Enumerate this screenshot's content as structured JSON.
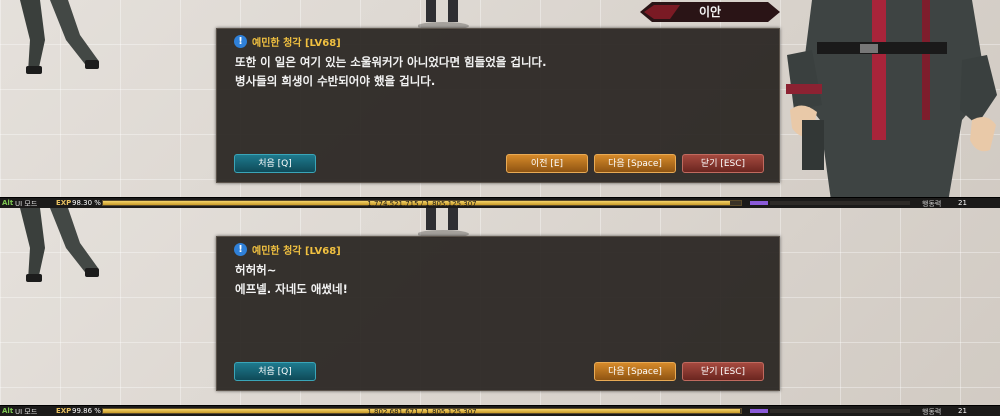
{
  "screens": [
    {
      "nameplate": "이안",
      "dialog": {
        "speaker": "예민한 청각 [LV68]",
        "lines": [
          "또한 이 일은 여기 있는 소울워커가 아니었다면 힘들었을 겁니다.",
          "병사들의 희생이 수반되어야 했을 겁니다."
        ],
        "buttons": {
          "first": "처음 [Q]",
          "prev": "이전 [E]",
          "next": "다음 [Space]",
          "close": "닫기 [ESC]"
        }
      },
      "status": {
        "alt": "Alt",
        "ui_mode": "UI 모드",
        "exp_label": "EXP",
        "exp_percent_text": "98.30 %",
        "exp_fraction": 0.983,
        "exp_values": "1,774,521,715 / 1,805,125,307",
        "activity_label": "행동력",
        "activity_value": "21"
      }
    },
    {
      "dialog": {
        "speaker": "예민한 청각 [LV68]",
        "lines": [
          "허허허~",
          "에프넬. 자네도 애썼네!"
        ],
        "buttons": {
          "first": "처음 [Q]",
          "next": "다음 [Space]",
          "close": "닫기 [ESC]"
        }
      },
      "status": {
        "alt": "Alt",
        "ui_mode": "UI 모드",
        "exp_label": "EXP",
        "exp_percent_text": "99.86 %",
        "exp_fraction": 0.9986,
        "exp_values": "1,802,681,671 / 1,805,125,307",
        "activity_label": "행동력",
        "activity_value": "21"
      }
    }
  ]
}
